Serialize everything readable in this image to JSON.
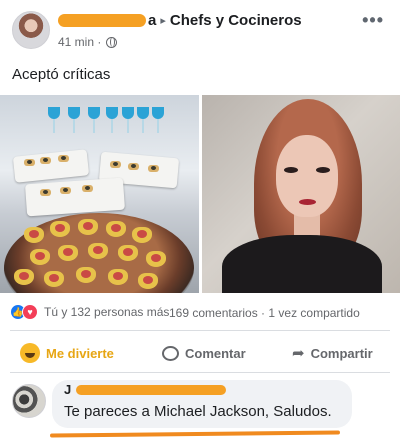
{
  "post": {
    "author_visible_suffix": "a",
    "arrow": "▸",
    "group_name": "Chefs y Cocineros",
    "time": "41 min ·",
    "text": "Aceptó críticas",
    "more_icon": "more-dots-icon"
  },
  "reactions": {
    "summary": "Tú y 132 personas más",
    "comments": "169 comentarios · 1 vez compartido",
    "icons": [
      "like-icon",
      "love-icon"
    ]
  },
  "actions": {
    "divierte_label": "Me divierte",
    "comment_label": "Comentar",
    "share_label": "Compartir"
  },
  "comment": {
    "author_initial": "J",
    "text": "Te pareces a Michael Jackson, Saludos."
  },
  "colors": {
    "accent_haha": "#f7b928",
    "like_blue": "#1877f2",
    "love_red": "#f33e58",
    "scribble_orange": "#f5a023"
  }
}
